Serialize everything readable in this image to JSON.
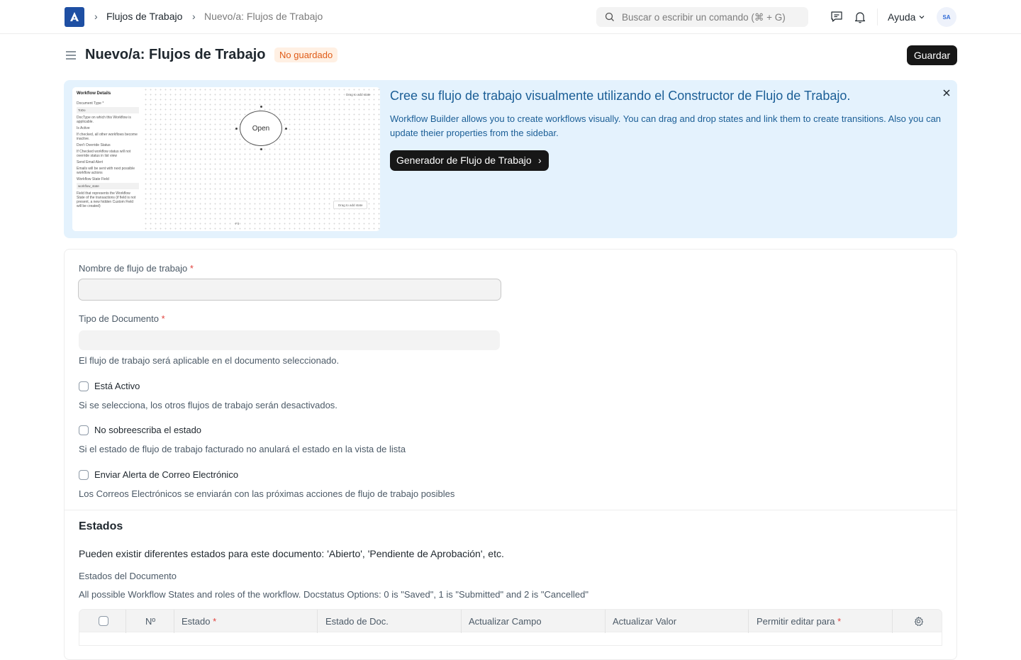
{
  "navbar": {
    "breadcrumbs": [
      "Flujos de Trabajo",
      "Nuevo/a: Flujos de Trabajo"
    ],
    "search_placeholder": "Buscar o escribir un comando (⌘ + G)",
    "help_label": "Ayuda",
    "avatar_initials": "SA"
  },
  "page": {
    "title": "Nuevo/a: Flujos de Trabajo",
    "status_badge": "No guardado",
    "save_label": "Guardar"
  },
  "banner": {
    "title": "Cree su flujo de trabajo visualmente utilizando el Constructor de Flujo de Trabajo.",
    "description": "Workflow Builder allows you to create workflows visually. You can drag and drop states and link them to create transitions. Also you can update theier properties from the sidebar.",
    "button_label": "Generador de Flujo de Trabajo",
    "preview": {
      "sidebar_title": "Workflow Details",
      "document_type_label": "Document Type *",
      "document_type_value": "ToDo",
      "document_type_help": "DocType on which this Workflow is applicable.",
      "is_active": "Is Active",
      "is_active_help": "If checked, all other workflows become inactive.",
      "dont_override": "Don't Override Status",
      "dont_override_help": "If Checked workflow status will not override status in list view",
      "send_email": "Send Email Alert",
      "send_email_help": "Emails will be sent with next possible workflow actions",
      "state_field_label": "Workflow State Field",
      "state_field_value": "workflow_state",
      "state_field_help": "Field that represents the Workflow State of the transactions (if field is not present, a new hidden Custom Field will be created)",
      "node_label": "Open",
      "drag_hint_top": "Drag to add state",
      "drag_hint_bottom": "Drag to add state",
      "zoom_fit": "Fit"
    }
  },
  "form": {
    "workflow_name_label": "Nombre de flujo de trabajo",
    "workflow_name_value": "",
    "document_type_label": "Tipo de Documento",
    "document_type_value": "",
    "document_type_help": "El flujo de trabajo será aplicable en el documento seleccionado.",
    "is_active_label": "Está Activo",
    "is_active_help": "Si se selecciona, los otros flujos de trabajo serán desactivados.",
    "override_label": "No sobreescriba el estado",
    "override_help": "Si el estado de flujo de trabajo facturado no anulará el estado en la vista de lista",
    "email_label": "Enviar Alerta de Correo Electrónico",
    "email_help": "Los Correos Electrónicos se enviarán con las próximas acciones de flujo de trabajo posibles",
    "required_mark": "*"
  },
  "states_section": {
    "title": "Estados",
    "intro": "Pueden existir diferentes estados para este documento: 'Abierto', 'Pendiente de Aprobación', etc.",
    "table_label": "Estados del Documento",
    "table_help": "All possible Workflow States and roles of the workflow. Docstatus Options: 0 is \"Saved\", 1 is \"Submitted\" and 2 is \"Cancelled\"",
    "columns": [
      "Nº",
      "Estado",
      "Estado de Doc.",
      "Actualizar Campo",
      "Actualizar Valor",
      "Permitir editar para"
    ]
  },
  "colors": {
    "accent_dark": "#171717",
    "banner_bg": "#e4f2fd",
    "banner_text": "#1b5e96",
    "unsaved_bg": "#fff0e3",
    "unsaved_text": "#e05c18",
    "required": "#e2433e"
  }
}
